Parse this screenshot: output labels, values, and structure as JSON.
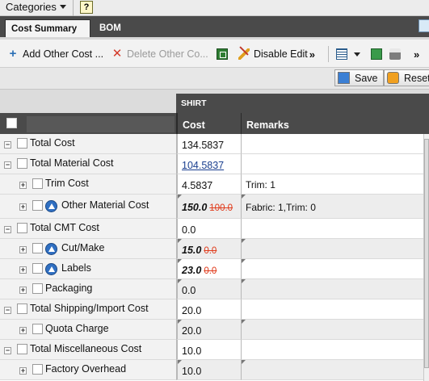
{
  "topbar": {
    "categories_label": "Categories",
    "help_label": "?"
  },
  "tabs": [
    {
      "label": "Cost Summary"
    },
    {
      "label": "BOM"
    }
  ],
  "toolbar": {
    "add_other_cost": "Add Other Cost ...",
    "delete_other_cost": "Delete Other Co...",
    "disable_edit": "Disable Edit",
    "overflow": "»"
  },
  "actions": {
    "save": "Save",
    "reset": "Reset"
  },
  "grid": {
    "group_header": "SHIRT",
    "columns": {
      "cost": "Cost",
      "remarks": "Remarks"
    },
    "rows": [
      {
        "label": "Total Cost",
        "cost": "134.5837",
        "remarks": ""
      },
      {
        "label": "Total Material Cost",
        "cost": "104.5837",
        "remarks": ""
      },
      {
        "label": "Trim Cost",
        "cost": "4.5837",
        "remarks": "Trim: 1"
      },
      {
        "label": "Other Material Cost",
        "cost": "150.0",
        "old_cost": "100.0",
        "remarks": "Fabric: 1,Trim: 0"
      },
      {
        "label": "Total CMT Cost",
        "cost": "0.0",
        "remarks": ""
      },
      {
        "label": "Cut/Make",
        "cost": "15.0",
        "old_cost": "0.0",
        "remarks": ""
      },
      {
        "label": "Labels",
        "cost": "23.0",
        "old_cost": "0.0",
        "remarks": ""
      },
      {
        "label": "Packaging",
        "cost": "0.0",
        "remarks": ""
      },
      {
        "label": "Total Shipping/Import Cost",
        "cost": "20.0",
        "remarks": ""
      },
      {
        "label": "Quota Charge",
        "cost": "20.0",
        "remarks": ""
      },
      {
        "label": "Total Miscellaneous Cost",
        "cost": "10.0",
        "remarks": ""
      },
      {
        "label": "Factory Overhead",
        "cost": "10.0",
        "remarks": ""
      }
    ]
  },
  "icons": {
    "add": "plus-icon",
    "delete": "x-icon",
    "excel": "excel-icon",
    "disable_edit": "pencil-icon",
    "grid": "grid-icon",
    "book": "book-icon",
    "print": "print-icon",
    "save": "save-icon",
    "reset": "reset-icon",
    "warning": "warning-icon"
  },
  "colors": {
    "header_dark": "#4a4a4a",
    "link": "#1a3f8f",
    "old_value": "#e03a1a",
    "warning_badge": "#2f6fc2"
  }
}
